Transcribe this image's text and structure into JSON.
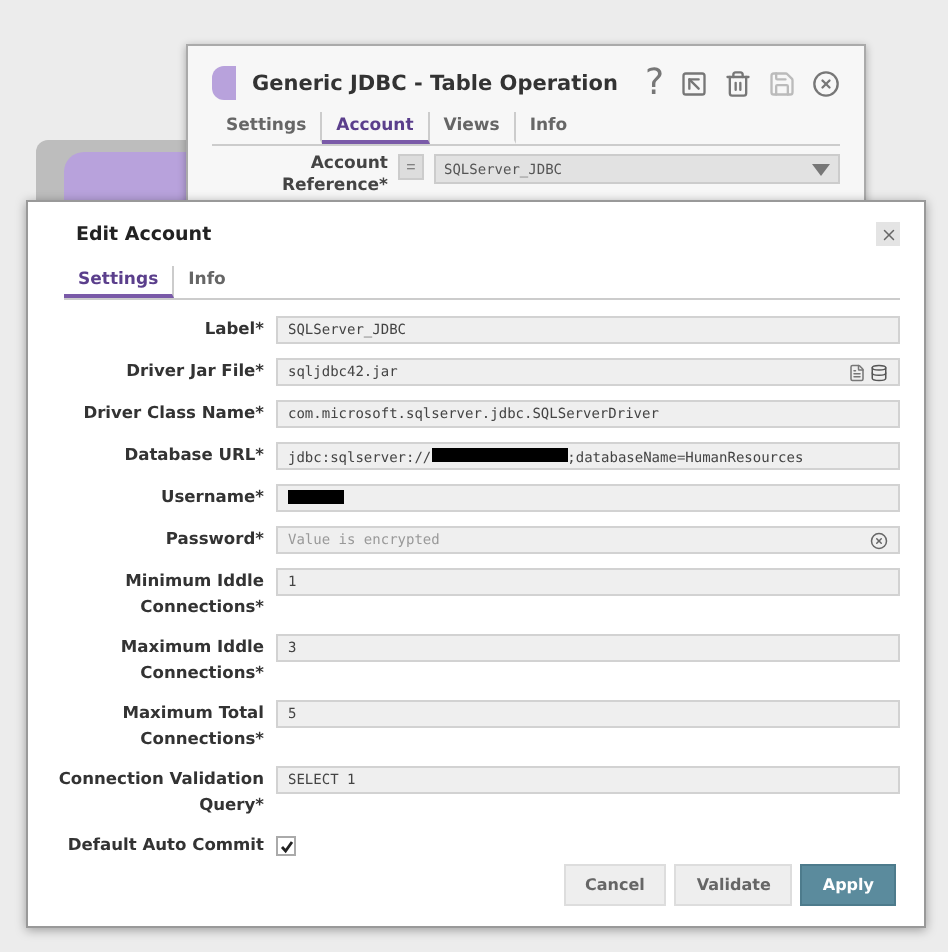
{
  "back_window": {
    "title": "Generic JDBC - Table Operation",
    "help_glyph": "?",
    "tabs": [
      {
        "label": "Settings",
        "selected": false
      },
      {
        "label": "Account",
        "selected": true
      },
      {
        "label": "Views",
        "selected": false
      },
      {
        "label": "Info",
        "selected": false
      }
    ],
    "account_reference": {
      "label": "Account Reference*",
      "expr_toggle": "=",
      "value": "SQLServer_JDBC"
    }
  },
  "dialog": {
    "title": "Edit Account",
    "tabs": [
      {
        "label": "Settings",
        "selected": true
      },
      {
        "label": "Info",
        "selected": false
      }
    ],
    "fields": [
      {
        "kind": "text",
        "label": "Label*",
        "value": "SQLServer_JDBC"
      },
      {
        "kind": "file",
        "label": "Driver Jar File*",
        "value": "sqljdbc42.jar"
      },
      {
        "kind": "text",
        "label": "Driver Class Name*",
        "value": "com.microsoft.sqlserver.jdbc.SQLServerDriver"
      },
      {
        "kind": "redacted",
        "label": "Database URL*",
        "value": "jdbc:sqlserver://",
        "value_after": ";databaseName=HumanResources"
      },
      {
        "kind": "redacted",
        "label": "Username*"
      },
      {
        "kind": "password",
        "label": "Password*",
        "placeholder": "Value is encrypted"
      },
      {
        "kind": "text",
        "label": "Minimum Iddle Connections*",
        "value": "1"
      },
      {
        "kind": "text",
        "label": "Maximum Iddle Connections*",
        "value": "3"
      },
      {
        "kind": "text",
        "label": "Maximum Total Connections*",
        "value": "5"
      },
      {
        "kind": "text",
        "label": "Connection Validation Query*",
        "value": "SELECT 1"
      },
      {
        "kind": "checkbox",
        "label": "Default Auto Commit",
        "checked": true
      }
    ],
    "buttons": [
      {
        "label": "Cancel",
        "kind": "plain"
      },
      {
        "label": "Validate",
        "kind": "plain"
      },
      {
        "label": "Apply",
        "kind": "primary"
      }
    ]
  }
}
